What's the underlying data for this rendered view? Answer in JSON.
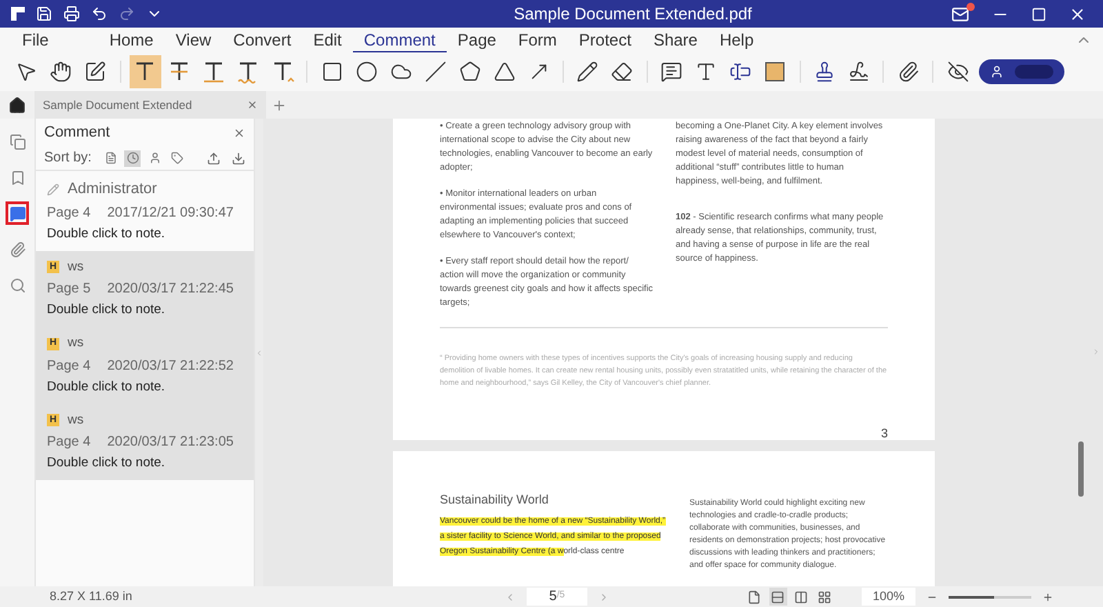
{
  "window": {
    "title": "Sample Document Extended.pdf",
    "notification": true
  },
  "menu": [
    {
      "label": "File",
      "selected": false
    },
    {
      "label": "Home",
      "selected": false
    },
    {
      "label": "View",
      "selected": false
    },
    {
      "label": "Convert",
      "selected": false
    },
    {
      "label": "Edit",
      "selected": false
    },
    {
      "label": "Comment",
      "selected": true
    },
    {
      "label": "Page",
      "selected": false
    },
    {
      "label": "Form",
      "selected": false
    },
    {
      "label": "Protect",
      "selected": false
    },
    {
      "label": "Share",
      "selected": false
    },
    {
      "label": "Help",
      "selected": false
    }
  ],
  "markup_tools": [
    {
      "kind": "highlight",
      "selected": true
    },
    {
      "kind": "strikethrough",
      "selected": false
    },
    {
      "kind": "underline",
      "selected": false
    },
    {
      "kind": "squiggly",
      "selected": false
    },
    {
      "kind": "insert",
      "selected": false
    }
  ],
  "document_tab": {
    "label": "Sample Document Extended"
  },
  "rail": [
    {
      "kind": "pages",
      "selected": false
    },
    {
      "kind": "bookmarks",
      "selected": false
    },
    {
      "kind": "comments",
      "selected": true
    },
    {
      "kind": "attachments",
      "selected": false
    },
    {
      "kind": "search",
      "selected": false
    }
  ],
  "comment_panel": {
    "title": "Comment",
    "sort_label": "Sort by:",
    "sort_options": [
      {
        "kind": "page",
        "selected": false
      },
      {
        "kind": "time",
        "selected": true
      },
      {
        "kind": "author",
        "selected": false
      },
      {
        "kind": "type",
        "selected": false
      }
    ],
    "comments": [
      {
        "kind": "note",
        "author": "Administrator",
        "page": "Page 4",
        "date": "2017/12/21 09:30:47",
        "text": "Double click to note.",
        "selected": false
      },
      {
        "kind": "highlight",
        "badge": "H",
        "author": "ws",
        "page": "Page 5",
        "date": "2020/03/17 21:22:45",
        "text": "Double click to note.",
        "selected": true
      },
      {
        "kind": "highlight",
        "badge": "H",
        "author": "ws",
        "page": "Page 4",
        "date": "2020/03/17 21:22:52",
        "text": "Double click to note.",
        "selected": true
      },
      {
        "kind": "highlight",
        "badge": "H",
        "author": "ws",
        "page": "Page 4",
        "date": "2020/03/17 21:23:05",
        "text": "Double click to note.",
        "selected": true
      }
    ]
  },
  "page_3": {
    "left_column": [
      "• Create a green technology advisory group with international scope to advise the City about new technologies, enabling Vancouver to become an early adopter;",
      "• Monitor international leaders on urban environmental issues; evaluate pros and cons of adapting an implementing policies that succeed elsewhere to Vancouver's context;",
      "• Every staff report should detail how the report/ action will move the organization or community towards greenest city goals and how it affects specific targets;"
    ],
    "right_column": [
      "becoming a One-Planet City. A key element involves raising awareness of the fact that beyond a fairly modest level of material needs, consumption of additional “stuff” contributes little to human happiness, well-being, and fulfilment.",
      "**102** - Scientific research confirms what many people already sense, that relationships, community, trust, and having a sense of purpose in life are the real source of happiness."
    ],
    "footnote": "“ Providing home owners with these types of incentives supports the City's goals of increasing housing supply and reducing demolition of livable homes. It can create new rental housing units, possibly even stratatitled units, while retaining the character of the home and neighbourhood,” says Gil Kelley, the City of Vancouver's chief planner.",
    "page_number": "3"
  },
  "page_5": {
    "heading": "Sustainability World",
    "highlighted_text": "Vancouver could be the home of a new “Sustainability World,” a sister facility to Science World, and similar to the proposed Oregon Sustainability Centre (a w",
    "plain_text": "orld-class centre",
    "right_column": "Sustainability World could highlight exciting new technologies and cradle-to-cradle products; collaborate with communities, businesses, and residents on demonstration projects; host provocative discussions with leading thinkers and practitioners; and offer space for community dialogue."
  },
  "status_bar": {
    "page_size": "8.27 X 11.69 in",
    "current_page": "5",
    "page_total": "/5",
    "view_modes": [
      {
        "kind": "single",
        "selected": false
      },
      {
        "kind": "continuous",
        "selected": true
      },
      {
        "kind": "two-page",
        "selected": false
      },
      {
        "kind": "grid",
        "selected": false
      }
    ],
    "zoom": "100%",
    "zoom_slider": {
      "level": 0.55
    }
  }
}
